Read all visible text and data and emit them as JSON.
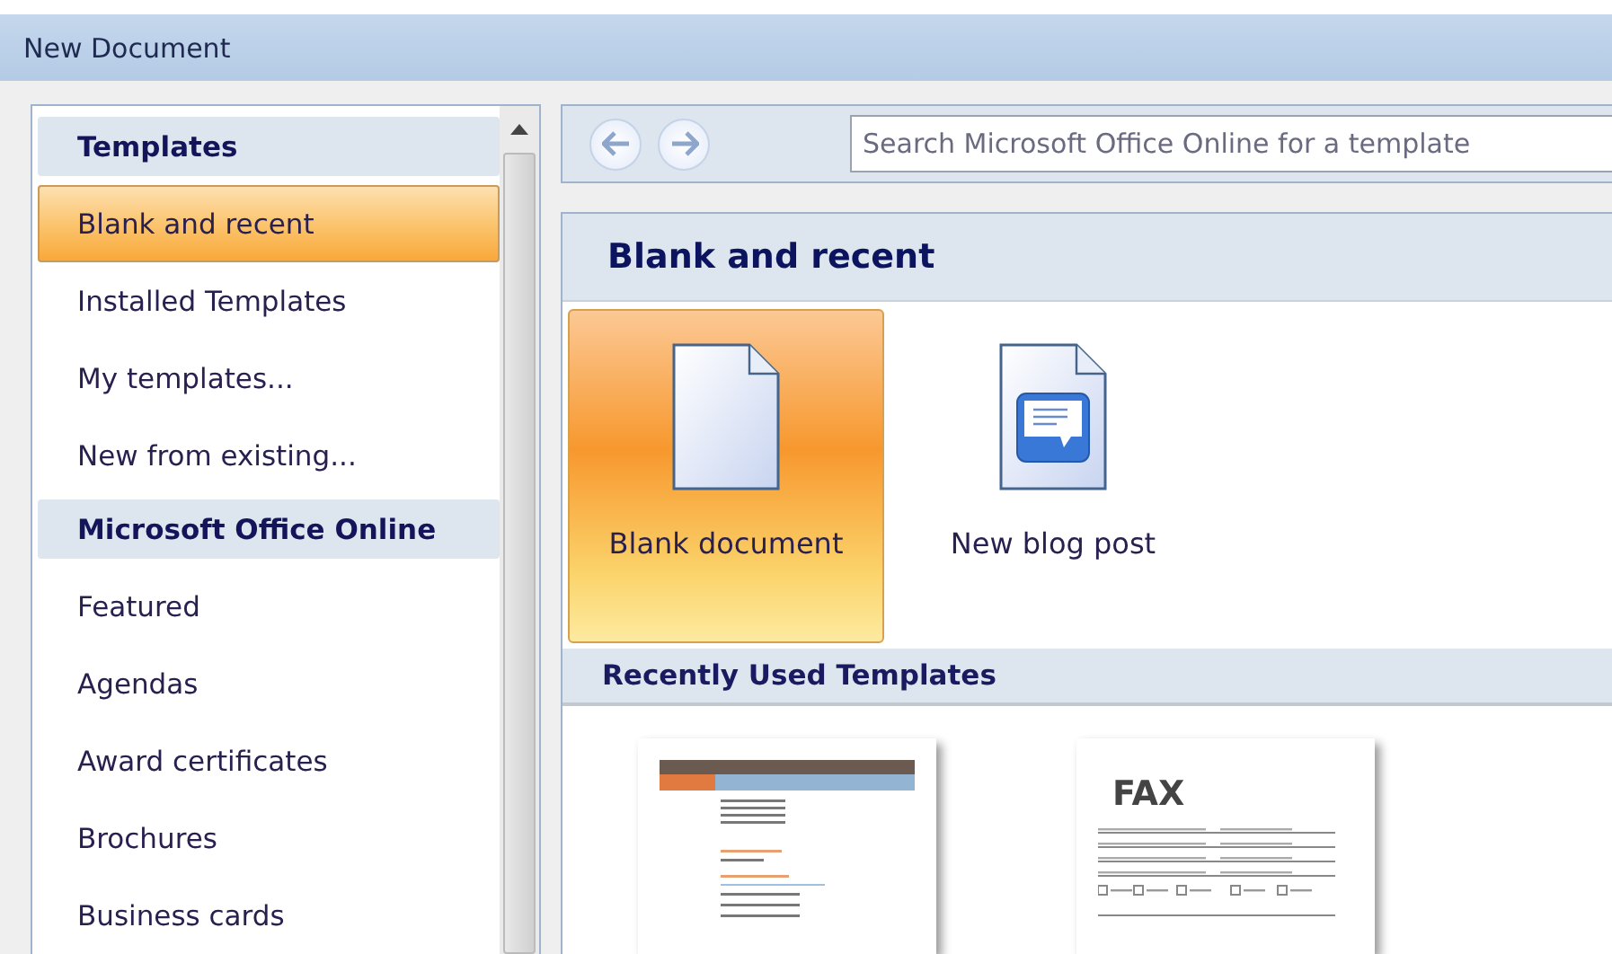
{
  "window": {
    "title": "New Document"
  },
  "sidebar": {
    "items": [
      {
        "kind": "header",
        "label": "Templates",
        "selected": false
      },
      {
        "kind": "item",
        "label": "Blank and recent",
        "selected": true
      },
      {
        "kind": "item",
        "label": "Installed Templates",
        "selected": false
      },
      {
        "kind": "item",
        "label": "My templates...",
        "selected": false
      },
      {
        "kind": "item",
        "label": "New from existing...",
        "selected": false
      },
      {
        "kind": "header",
        "label": "Microsoft Office Online",
        "selected": false
      },
      {
        "kind": "item",
        "label": "Featured",
        "selected": false
      },
      {
        "kind": "item",
        "label": "Agendas",
        "selected": false
      },
      {
        "kind": "item",
        "label": "Award certificates",
        "selected": false
      },
      {
        "kind": "item",
        "label": "Brochures",
        "selected": false
      },
      {
        "kind": "item",
        "label": "Business cards",
        "selected": false
      }
    ]
  },
  "search": {
    "placeholder": "Search Microsoft Office Online for a template"
  },
  "section": {
    "title": "Blank and recent",
    "tiles": [
      {
        "kind": "blank",
        "label": "Blank document",
        "selected": true
      },
      {
        "kind": "blog",
        "label": "New blog post",
        "selected": false
      }
    ]
  },
  "recent": {
    "title": "Recently Used Templates",
    "thumbnails": [
      {
        "kind": "resume"
      },
      {
        "kind": "fax",
        "heading": "FAX"
      }
    ]
  }
}
